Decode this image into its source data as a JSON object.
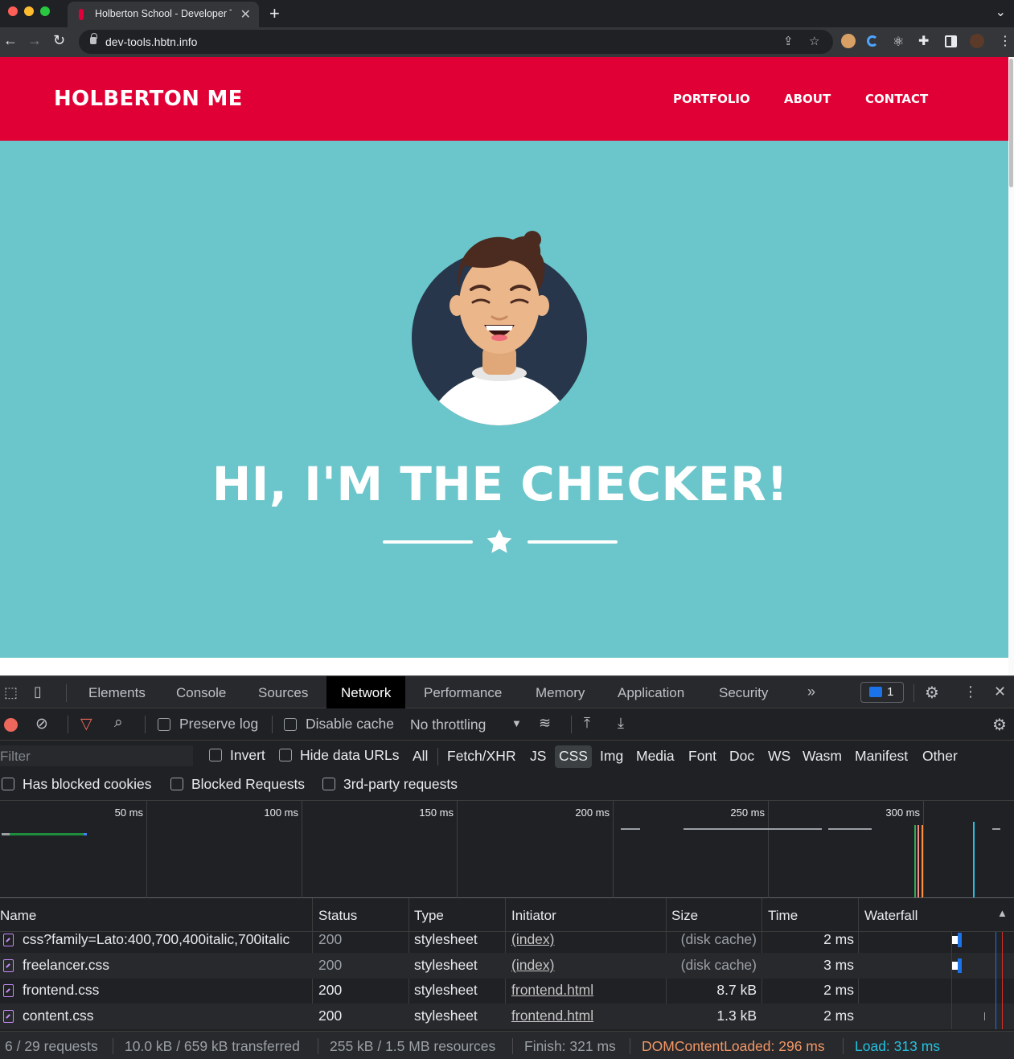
{
  "browser": {
    "tab_title": "Holberton School - Developer Tools",
    "url": "dev-tools.hbtn.info"
  },
  "site": {
    "brand": "HOLBERTON ME",
    "nav": [
      "PORTFOLIO",
      "ABOUT",
      "CONTACT"
    ],
    "hero_title": "HI, I'M THE CHECKER!",
    "colors": {
      "nav_bg": "#e10035",
      "hero_bg": "#6bc6cb"
    }
  },
  "devtools": {
    "tabs": [
      "Elements",
      "Console",
      "Sources",
      "Network",
      "Performance",
      "Memory",
      "Application",
      "Security"
    ],
    "active_tab": "Network",
    "issues_count": "1",
    "toolbar": {
      "preserve_log": "Preserve log",
      "disable_cache": "Disable cache",
      "throttling": "No throttling"
    },
    "filter": {
      "placeholder": "Filter",
      "invert": "Invert",
      "hide_data_urls": "Hide data URLs",
      "types": [
        "All",
        "Fetch/XHR",
        "JS",
        "CSS",
        "Img",
        "Media",
        "Font",
        "Doc",
        "WS",
        "Wasm",
        "Manifest",
        "Other"
      ],
      "selected_type": "CSS",
      "has_blocked_cookies": "Has blocked cookies",
      "blocked_requests": "Blocked Requests",
      "third_party": "3rd-party requests"
    },
    "timeline_ticks": [
      "50 ms",
      "100 ms",
      "150 ms",
      "200 ms",
      "250 ms",
      "300 ms"
    ],
    "columns": [
      "Name",
      "Status",
      "Type",
      "Initiator",
      "Size",
      "Time",
      "Waterfall"
    ],
    "requests": [
      {
        "name": "css?family=Lato:400,700,400italic,700italic",
        "status": "200",
        "type": "stylesheet",
        "initiator": "(index)",
        "size": "(disk cache)",
        "time": "2 ms"
      },
      {
        "name": "freelancer.css",
        "status": "200",
        "type": "stylesheet",
        "initiator": "(index)",
        "size": "(disk cache)",
        "time": "3 ms"
      },
      {
        "name": "frontend.css",
        "status": "200",
        "type": "stylesheet",
        "initiator": "frontend.html",
        "size": "8.7 kB",
        "time": "2 ms"
      },
      {
        "name": "content.css",
        "status": "200",
        "type": "stylesheet",
        "initiator": "frontend.html",
        "size": "1.3 kB",
        "time": "2 ms"
      }
    ],
    "status": {
      "requests": "6 / 29 requests",
      "transferred": "10.0 kB / 659 kB transferred",
      "resources": "255 kB / 1.5 MB resources",
      "finish": "Finish: 321 ms",
      "dom_content_loaded": "DOMContentLoaded: 296 ms",
      "load": "Load: 313 ms"
    }
  }
}
